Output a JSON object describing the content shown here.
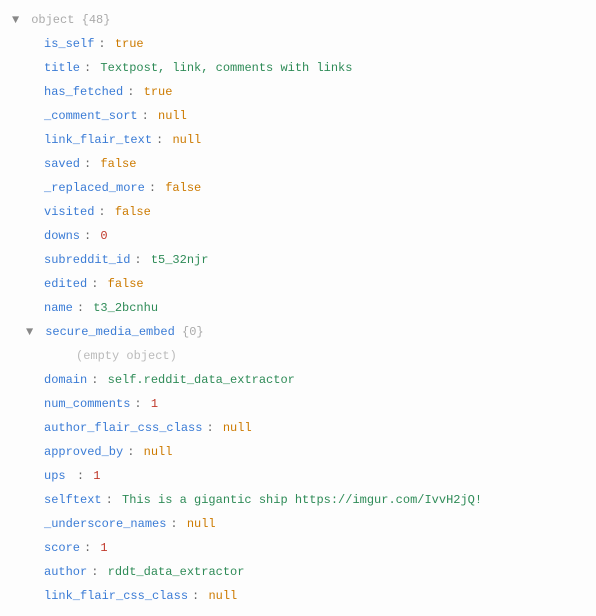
{
  "root": {
    "typeLabel": "object",
    "count": "{48}"
  },
  "nested": {
    "key": "secure_media_embed",
    "count": "{0}",
    "emptyText": "(empty object)"
  },
  "props": [
    {
      "key": "is_self",
      "value": "true",
      "type": "bool"
    },
    {
      "key": "title",
      "value": "Textpost, link, comments with links",
      "type": "string"
    },
    {
      "key": "has_fetched",
      "value": "true",
      "type": "bool"
    },
    {
      "key": "_comment_sort",
      "value": "null",
      "type": "null"
    },
    {
      "key": "link_flair_text",
      "value": "null",
      "type": "null"
    },
    {
      "key": "saved",
      "value": "false",
      "type": "bool"
    },
    {
      "key": "_replaced_more",
      "value": "false",
      "type": "bool"
    },
    {
      "key": "visited",
      "value": "false",
      "type": "bool"
    },
    {
      "key": "downs",
      "value": "0",
      "type": "number"
    },
    {
      "key": "subreddit_id",
      "value": "t5_32njr",
      "type": "string"
    },
    {
      "key": "edited",
      "value": "false",
      "type": "bool"
    },
    {
      "key": "name",
      "value": "t3_2bcnhu",
      "type": "string"
    }
  ],
  "props2": [
    {
      "key": "domain",
      "value": "self.reddit_data_extractor",
      "type": "string"
    },
    {
      "key": "num_comments",
      "value": "1",
      "type": "number"
    },
    {
      "key": "author_flair_css_class",
      "value": "null",
      "type": "null"
    },
    {
      "key": "approved_by",
      "value": "null",
      "type": "null"
    },
    {
      "key": "ups ",
      "value": "1",
      "type": "number"
    },
    {
      "key": "selftext",
      "value": "This is a gigantic ship https://imgur.com/IvvH2jQ!",
      "type": "string"
    },
    {
      "key": "_underscore_names",
      "value": "null",
      "type": "null"
    },
    {
      "key": "score",
      "value": "1",
      "type": "number"
    },
    {
      "key": "author",
      "value": "rddt_data_extractor",
      "type": "string"
    },
    {
      "key": "link_flair_css_class",
      "value": "null",
      "type": "null"
    }
  ]
}
